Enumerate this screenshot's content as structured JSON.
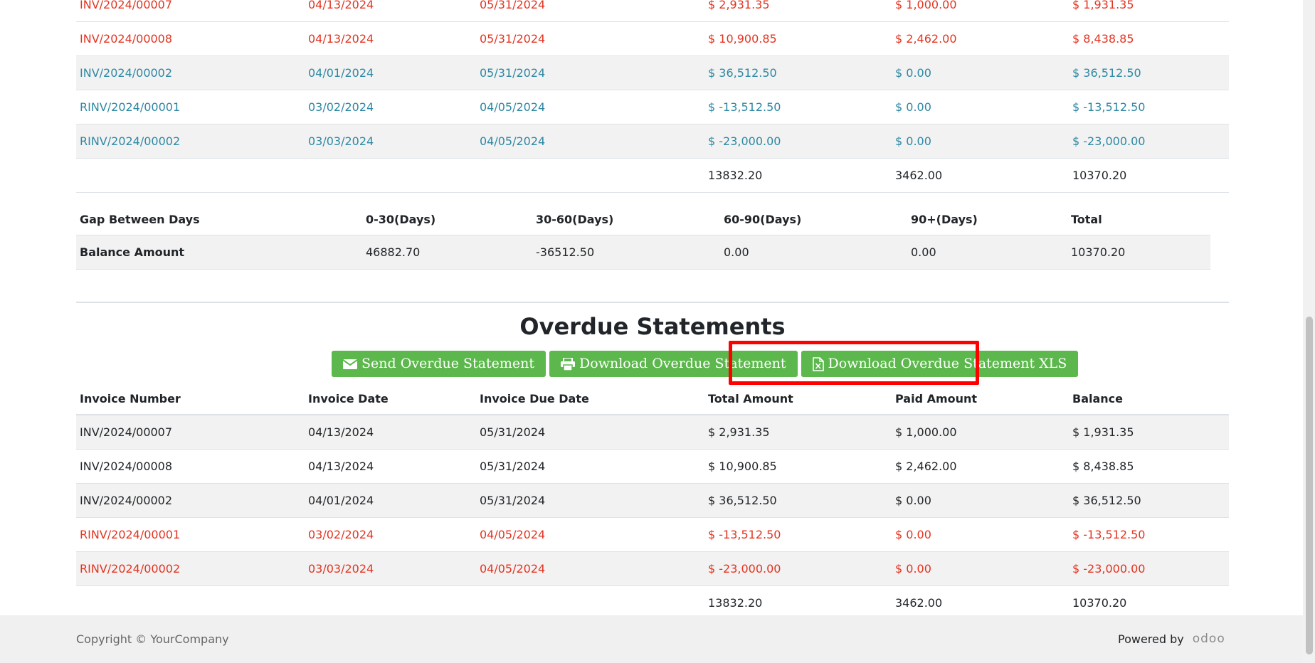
{
  "top_table": {
    "rows": [
      {
        "number": "INV/2024/00007",
        "date": "04/13/2024",
        "due": "05/31/2024",
        "total": "$ 2,931.35",
        "paid": "$ 1,000.00",
        "balance": "$ 1,931.35",
        "color": "red"
      },
      {
        "number": "INV/2024/00008",
        "date": "04/13/2024",
        "due": "05/31/2024",
        "total": "$ 10,900.85",
        "paid": "$ 2,462.00",
        "balance": "$ 8,438.85",
        "color": "red"
      },
      {
        "number": "INV/2024/00002",
        "date": "04/01/2024",
        "due": "05/31/2024",
        "total": "$ 36,512.50",
        "paid": "$ 0.00",
        "balance": "$ 36,512.50",
        "color": "blue"
      },
      {
        "number": "RINV/2024/00001",
        "date": "03/02/2024",
        "due": "04/05/2024",
        "total": "$ -13,512.50",
        "paid": "$ 0.00",
        "balance": "$ -13,512.50",
        "color": "blue"
      },
      {
        "number": "RINV/2024/00002",
        "date": "03/03/2024",
        "due": "04/05/2024",
        "total": "$ -23,000.00",
        "paid": "$ 0.00",
        "balance": "$ -23,000.00",
        "color": "blue"
      }
    ],
    "totals": {
      "total": "13832.20",
      "paid": "3462.00",
      "balance": "10370.20"
    }
  },
  "gap_table": {
    "headers": [
      "Gap Between Days",
      "0-30(Days)",
      "30-60(Days)",
      "60-90(Days)",
      "90+(Days)",
      "Total"
    ],
    "balance_label": "Balance Amount",
    "values": [
      "46882.70",
      "-36512.50",
      "0.00",
      "0.00",
      "10370.20"
    ]
  },
  "overdue": {
    "title": "Overdue Statements",
    "buttons": {
      "send": "Send Overdue Statement",
      "download": "Download Overdue Statement",
      "download_xls": "Download Overdue Statement XLS"
    },
    "headers": [
      "Invoice Number",
      "Invoice Date",
      "Invoice Due Date",
      "Total Amount",
      "Paid Amount",
      "Balance"
    ],
    "rows": [
      {
        "number": "INV/2024/00007",
        "date": "04/13/2024",
        "due": "05/31/2024",
        "total": "$ 2,931.35",
        "paid": "$ 1,000.00",
        "balance": "$ 1,931.35",
        "color": "default"
      },
      {
        "number": "INV/2024/00008",
        "date": "04/13/2024",
        "due": "05/31/2024",
        "total": "$ 10,900.85",
        "paid": "$ 2,462.00",
        "balance": "$ 8,438.85",
        "color": "default"
      },
      {
        "number": "INV/2024/00002",
        "date": "04/01/2024",
        "due": "05/31/2024",
        "total": "$ 36,512.50",
        "paid": "$ 0.00",
        "balance": "$ 36,512.50",
        "color": "default"
      },
      {
        "number": "RINV/2024/00001",
        "date": "03/02/2024",
        "due": "04/05/2024",
        "total": "$ -13,512.50",
        "paid": "$ 0.00",
        "balance": "$ -13,512.50",
        "color": "red"
      },
      {
        "number": "RINV/2024/00002",
        "date": "03/03/2024",
        "due": "04/05/2024",
        "total": "$ -23,000.00",
        "paid": "$ 0.00",
        "balance": "$ -23,000.00",
        "color": "red"
      }
    ],
    "totals": {
      "total": "13832.20",
      "paid": "3462.00",
      "balance": "10370.20"
    }
  },
  "footer": {
    "copyright": "Copyright © YourCompany",
    "powered_by": "Powered by",
    "brand": "odoo"
  },
  "colors": {
    "red": "#e4331f",
    "blue": "#2e88a3",
    "button_green": "#5cb84c",
    "highlight": "#ff0000"
  },
  "icons": [
    "envelope-icon",
    "print-icon",
    "file-excel-icon"
  ]
}
